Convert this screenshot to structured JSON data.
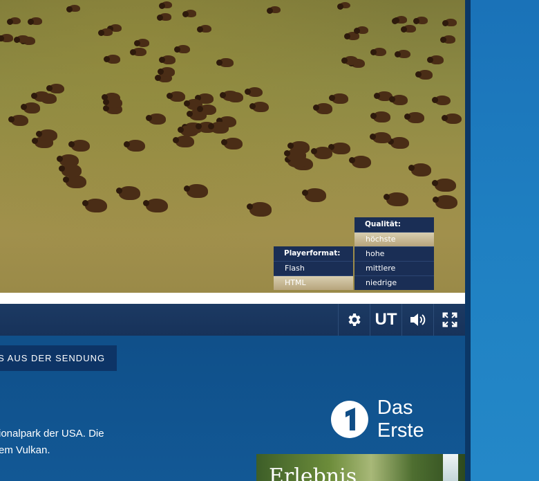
{
  "player": {
    "format_menu": {
      "heading": "Playerformat:",
      "options": [
        "Flash",
        "HTML"
      ],
      "selected": "HTML"
    },
    "quality_menu": {
      "heading": "Qualität:",
      "options": [
        "höchste",
        "hohe",
        "mittlere",
        "niedrige"
      ],
      "selected": "höchste"
    },
    "controls": {
      "settings_icon": "gear-icon",
      "subtitles_label": "UT",
      "volume_icon": "speaker-icon",
      "fullscreen_icon": "fullscreen-icon"
    }
  },
  "page": {
    "tab_label": "OS AUS DER SENDUNG",
    "description_lines": [
      "ionalpark der USA. Die",
      "em Vulkan."
    ],
    "logo_text": "Das Erste",
    "promo_title": "Erlebnis"
  },
  "colors": {
    "background": "#0f4d86",
    "control_bar": "#17325a",
    "menu_bg": "#1a2e55",
    "selected_item": "#b7a57c",
    "right_rail": "#1f80c2"
  }
}
